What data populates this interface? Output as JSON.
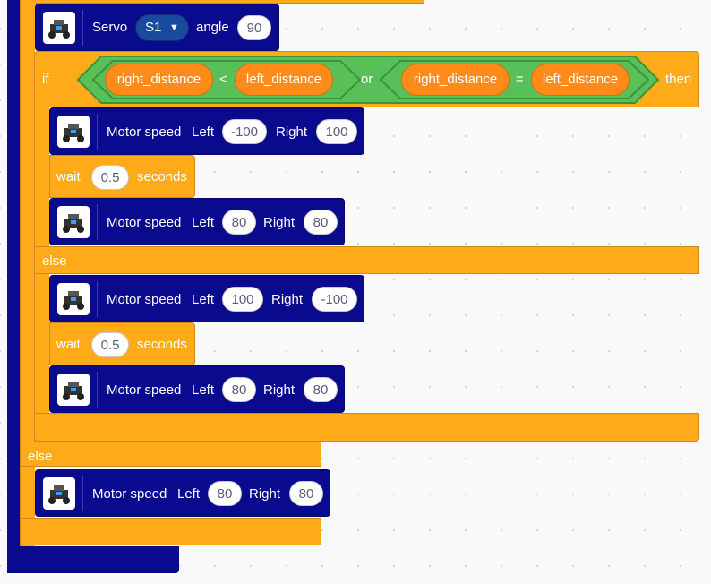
{
  "blocks": {
    "servo": {
      "label": "Servo",
      "port": "S1",
      "angle_label": "angle",
      "angle": "90"
    },
    "outer_else": "else",
    "if_block": {
      "if_label": "if",
      "then_label": "then",
      "left_cmp": {
        "a": "right_distance",
        "op": "<",
        "b": "left_distance"
      },
      "or_label": "or",
      "right_cmp": {
        "a": "right_distance",
        "op": "=",
        "b": "left_distance"
      },
      "else_label": "else"
    },
    "motor_label": "Motor speed",
    "left_label": "Left",
    "right_label": "Right",
    "wait_label": "wait",
    "seconds_label": "seconds",
    "motor1": {
      "left": "-100",
      "right": "100"
    },
    "wait1": "0.5",
    "motor2": {
      "left": "80",
      "right": "80"
    },
    "motor3": {
      "left": "100",
      "right": "-100"
    },
    "wait2": "0.5",
    "motor4": {
      "left": "80",
      "right": "80"
    },
    "motor5": {
      "left": "80",
      "right": "80"
    }
  },
  "colors": {
    "control": "#ffab19",
    "operator": "#59c059",
    "motion": "#0a0a8e",
    "reporter": "#ff8c1a"
  },
  "icons": {
    "robot": "robot-car-icon",
    "dropdown": "caret-down-icon"
  }
}
